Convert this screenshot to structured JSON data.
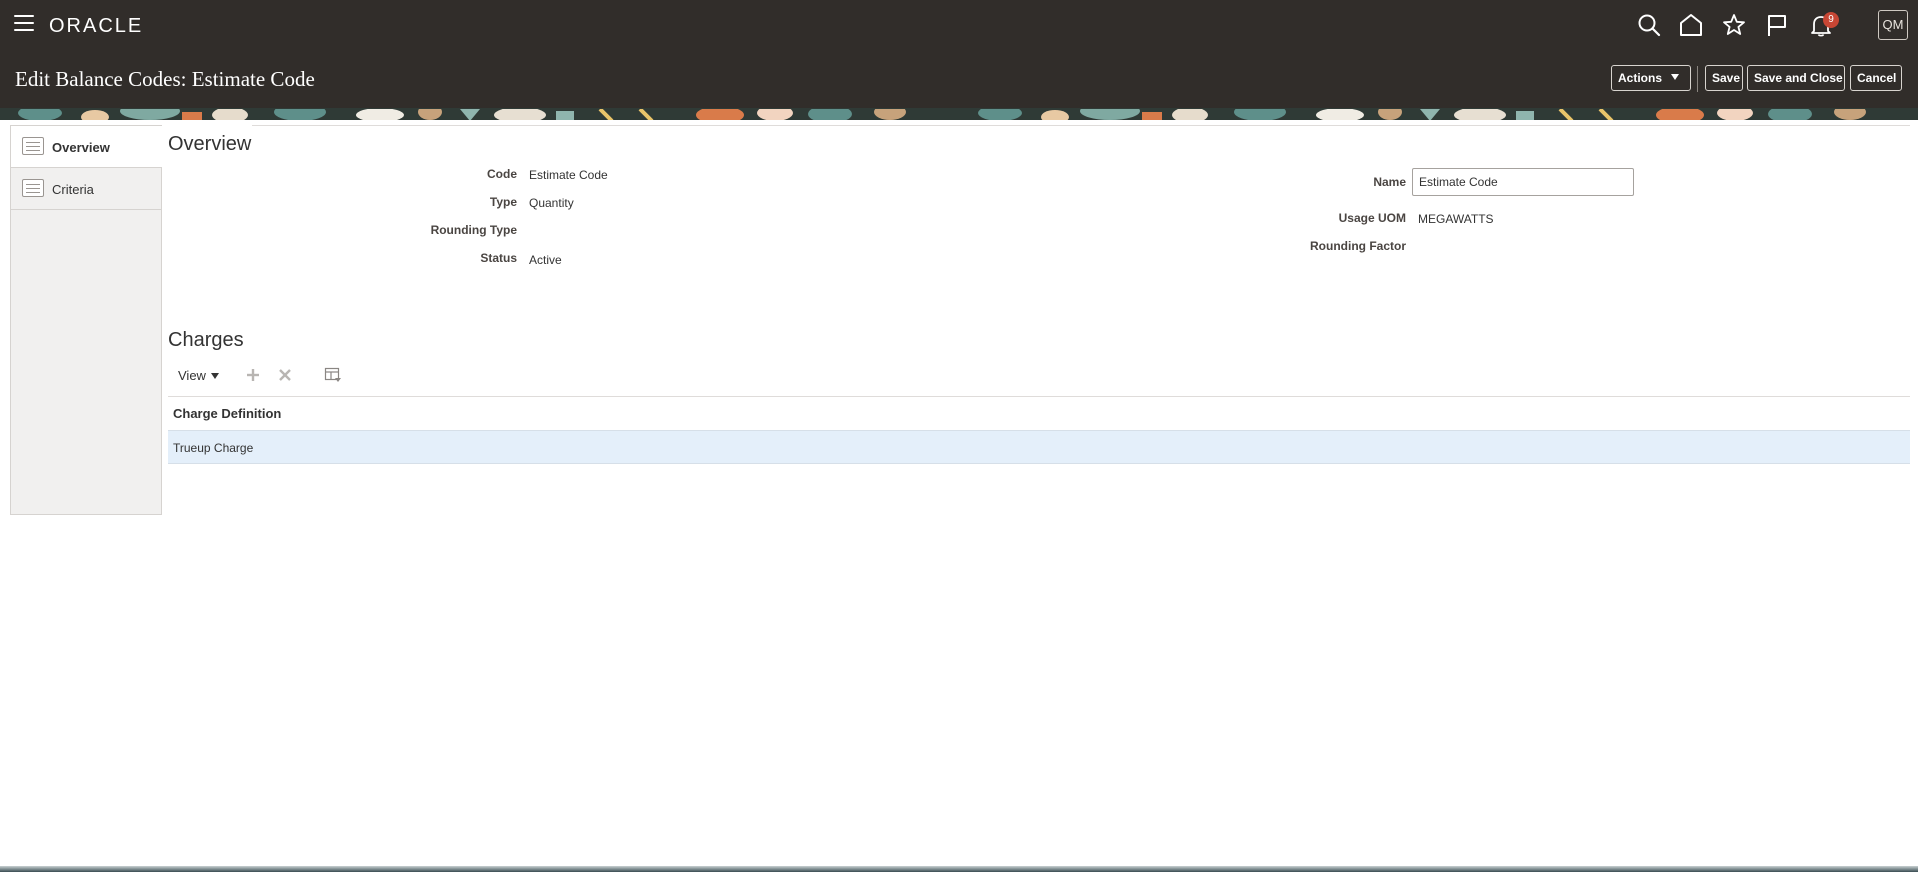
{
  "header": {
    "logo": "ORACLE",
    "notification_count": "9",
    "user_initials": "QM",
    "icons": [
      "menu-icon",
      "search-icon",
      "home-icon",
      "star-icon",
      "flag-icon",
      "bell-icon"
    ]
  },
  "page": {
    "title": "Edit Balance Codes: Estimate Code",
    "actions_label": "Actions",
    "save_label": "Save",
    "save_close_label": "Save and Close",
    "cancel_label": "Cancel"
  },
  "side_nav": {
    "items": [
      {
        "label": "Overview",
        "active": true
      },
      {
        "label": "Criteria",
        "active": false
      }
    ]
  },
  "overview": {
    "title": "Overview",
    "code_label": "Code",
    "code_value": "Estimate Code",
    "type_label": "Type",
    "type_value": "Quantity",
    "rounding_type_label": "Rounding Type",
    "rounding_type_value": "",
    "status_label": "Status",
    "status_value": "Active",
    "name_label": "Name",
    "name_value": "Estimate Code",
    "usage_uom_label": "Usage UOM",
    "usage_uom_value": "MEGAWATTS",
    "rounding_factor_label": "Rounding Factor",
    "rounding_factor_value": ""
  },
  "charges": {
    "title": "Charges",
    "view_label": "View",
    "column_header": "Charge Definition",
    "rows": [
      {
        "charge_definition": "Trueup Charge"
      }
    ]
  },
  "colors": {
    "header_bg": "#312d2a",
    "selected_row": "#e4effa",
    "badge": "#c74634"
  }
}
